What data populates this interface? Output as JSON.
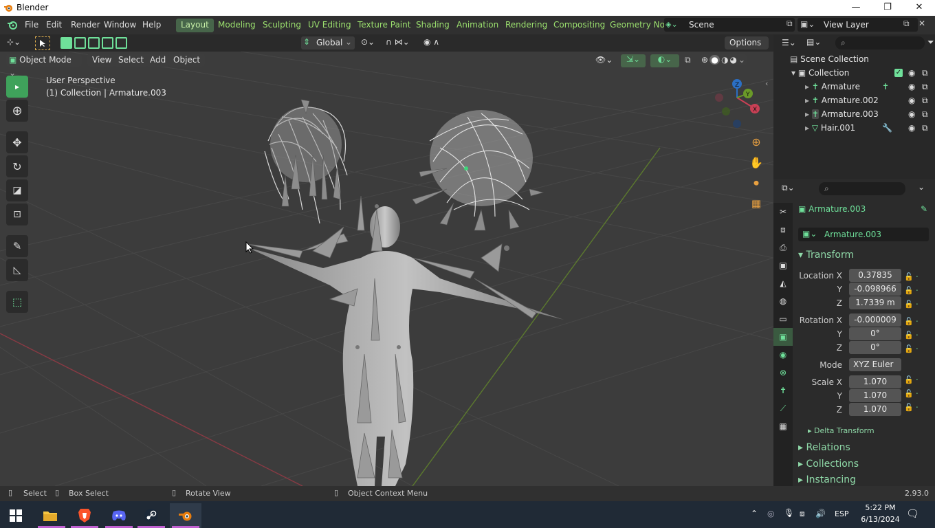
{
  "window": {
    "title": "Blender",
    "controls": [
      "—",
      "❐",
      "✕"
    ]
  },
  "menubar": {
    "menus": [
      "File",
      "Edit",
      "Render",
      "Window",
      "Help"
    ],
    "workspaces": [
      "Layout",
      "Modeling",
      "Sculpting",
      "UV Editing",
      "Texture Paint",
      "Shading",
      "Animation",
      "Rendering",
      "Compositing",
      "Geometry No"
    ],
    "active_workspace": "Layout",
    "scene": "Scene",
    "view_layer": "View Layer"
  },
  "toolheader": {
    "transform_orientation": "Global",
    "options_label": "Options"
  },
  "viewport_header": {
    "mode": "Object Mode",
    "menus": [
      "View",
      "Select",
      "Add",
      "Object"
    ]
  },
  "viewport": {
    "perspective": "User Perspective",
    "context": "(1) Collection | Armature.003"
  },
  "outliner": {
    "root": "Scene Collection",
    "collection": "Collection",
    "items": [
      {
        "name": "Armature"
      },
      {
        "name": "Armature.002"
      },
      {
        "name": "Armature.003"
      },
      {
        "name": "Hair.001"
      }
    ]
  },
  "properties": {
    "object_name": "Armature.003",
    "name_field": "Armature.003",
    "transform_title": "Transform",
    "location_label": "Location X",
    "location": [
      "0.37835",
      "-0.098966",
      "1.7339 m"
    ],
    "rotation_label": "Rotation X",
    "rotation": [
      "-0.000009",
      "0°",
      "0°"
    ],
    "mode_label": "Mode",
    "rotation_mode": "XYZ Euler",
    "scale_label": "Scale X",
    "scale": [
      "1.070",
      "1.070",
      "1.070"
    ],
    "axis_y": "Y",
    "axis_z": "Z",
    "delta_transform": "Delta Transform",
    "sections": [
      "Relations",
      "Collections",
      "Instancing"
    ]
  },
  "statusbar": {
    "select": "Select",
    "box_select": "Box Select",
    "rotate": "Rotate View",
    "context_menu": "Object Context Menu",
    "version": "2.93.0"
  },
  "taskbar": {
    "language": "ESP",
    "time": "5:22 PM",
    "date": "6/13/2024"
  },
  "colors": {
    "accent": "#6fe09a",
    "active_tab": "#47654a",
    "viewport": "#3c3c3c"
  }
}
